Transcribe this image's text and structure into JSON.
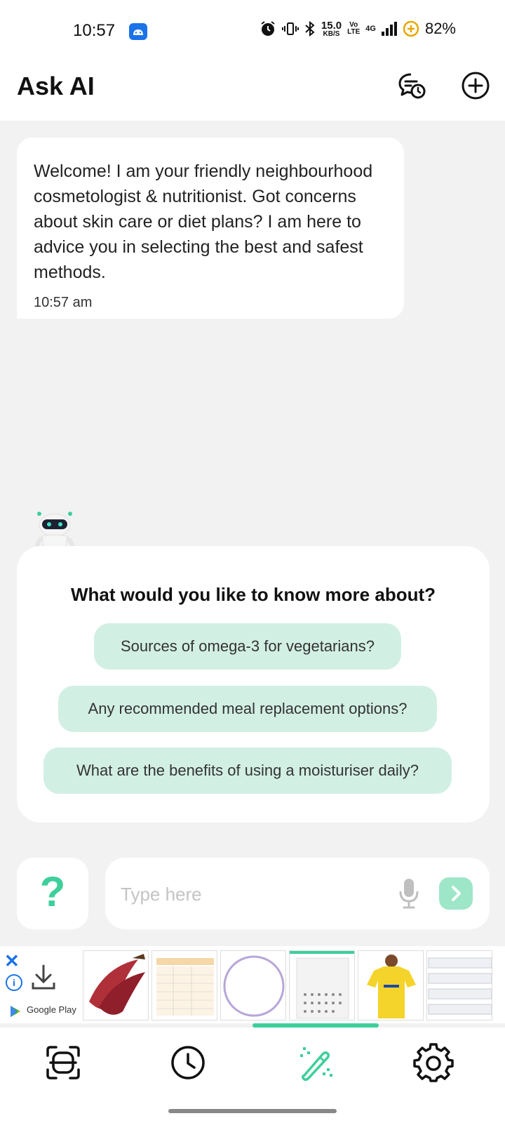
{
  "status_bar": {
    "time": "10:57",
    "net_speed_value": "15.0",
    "net_speed_unit": "KB/S",
    "volte_top": "Vo",
    "volte_bottom": "LTE",
    "network": "4G",
    "battery": "82%"
  },
  "header": {
    "title": "Ask AI",
    "history_icon": "chat-history-icon",
    "new_chat_icon": "plus-circle-icon"
  },
  "welcome": {
    "text": "Welcome! I am your friendly neighbourhood cosmetologist & nutritionist. Got concerns about skin care or diet plans? I am here to advice you in selecting the best and safest methods.",
    "time": "10:57 am"
  },
  "suggestions": {
    "title": "What would you like to know more about?",
    "items": [
      "Sources of omega-3 for vegetarians?",
      "Any recommended meal replacement options?",
      "What are the benefits of using a moisturiser daily?"
    ]
  },
  "input": {
    "help_label": "?",
    "placeholder": "Type here"
  },
  "ad": {
    "store_label": "Google Play",
    "info_label": "i",
    "close_label": "✕"
  },
  "colors": {
    "accent": "#3ecf9b",
    "chip_bg": "#d2efe4",
    "send_bg": "#9ee6c8",
    "ad_blue": "#1a73e8"
  }
}
